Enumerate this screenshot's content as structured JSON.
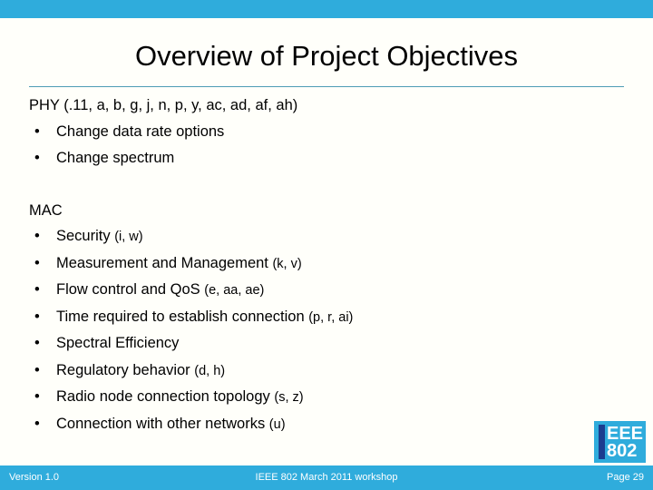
{
  "slide": {
    "title": "Overview of Project Objectives",
    "accent_color": "#2FACDC",
    "divider_color": "#4E9DB5",
    "background_color": "#FFFFFA",
    "text_color": "#000000"
  },
  "sections": [
    {
      "heading": "PHY (.11, a, b, g, j, n, p, y, ac, ad, af, ah)",
      "bullets": [
        {
          "text": "Change data rate options",
          "paren": ""
        },
        {
          "text": "Change spectrum",
          "paren": ""
        }
      ]
    },
    {
      "heading": "MAC",
      "bullets": [
        {
          "text": "Security ",
          "paren": "(i, w)"
        },
        {
          "text": "Measurement and Management ",
          "paren": "(k, v)"
        },
        {
          "text": "Flow control and QoS ",
          "paren": "(e, aa, ae)"
        },
        {
          "text": "Time required to establish connection ",
          "paren": "(p, r, ai)"
        },
        {
          "text": "Spectral Efficiency",
          "paren": ""
        },
        {
          "text": "Regulatory behavior ",
          "paren": "(d, h)"
        },
        {
          "text": "Radio node connection topology ",
          "paren": "(s, z)"
        },
        {
          "text": "Connection with other networks ",
          "paren": "(u)"
        }
      ]
    }
  ],
  "bullet_glyph": "•",
  "logo": {
    "line1": "EEE",
    "line2": "802",
    "bar_color": "#1B3D8F",
    "box_color": "#2FACDC",
    "text_color": "#FFFFFF"
  },
  "footer": {
    "version": "Version 1.0",
    "center": "IEEE 802 March 2011 workshop",
    "page": "Page 29",
    "background_color": "#2FACDC",
    "text_color": "#FFFFFF"
  }
}
